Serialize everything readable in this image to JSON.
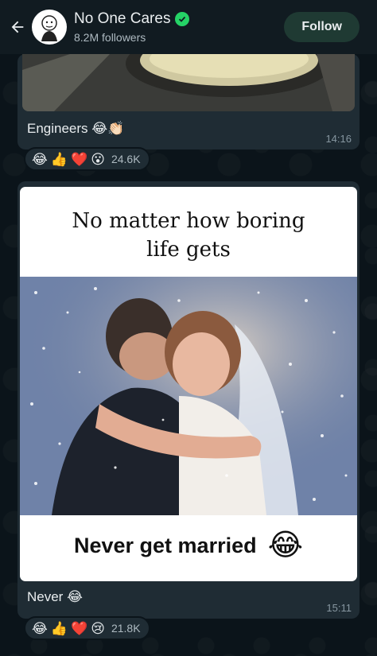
{
  "header": {
    "back_icon": "arrow-left-icon",
    "channel_name": "No One Cares",
    "followers": "8.2M followers",
    "follow_label": "Follow",
    "verified_icon": "verified-check-icon",
    "accent": "#25d366"
  },
  "messages": [
    {
      "caption": "Engineers 😂👏🏻",
      "time": "14:16",
      "reactions": [
        "😂",
        "👍",
        "❤️",
        "😮"
      ],
      "reaction_count": "24.6K"
    },
    {
      "meme_top_line1": "No matter how boring",
      "meme_top_line2": "life gets",
      "meme_bottom_text": "Never get married",
      "meme_bottom_emoji": "😂",
      "caption": "Never 😂",
      "time": "15:11",
      "reactions": [
        "😂",
        "👍",
        "❤️",
        "😢"
      ],
      "reaction_count": "21.8K"
    }
  ]
}
